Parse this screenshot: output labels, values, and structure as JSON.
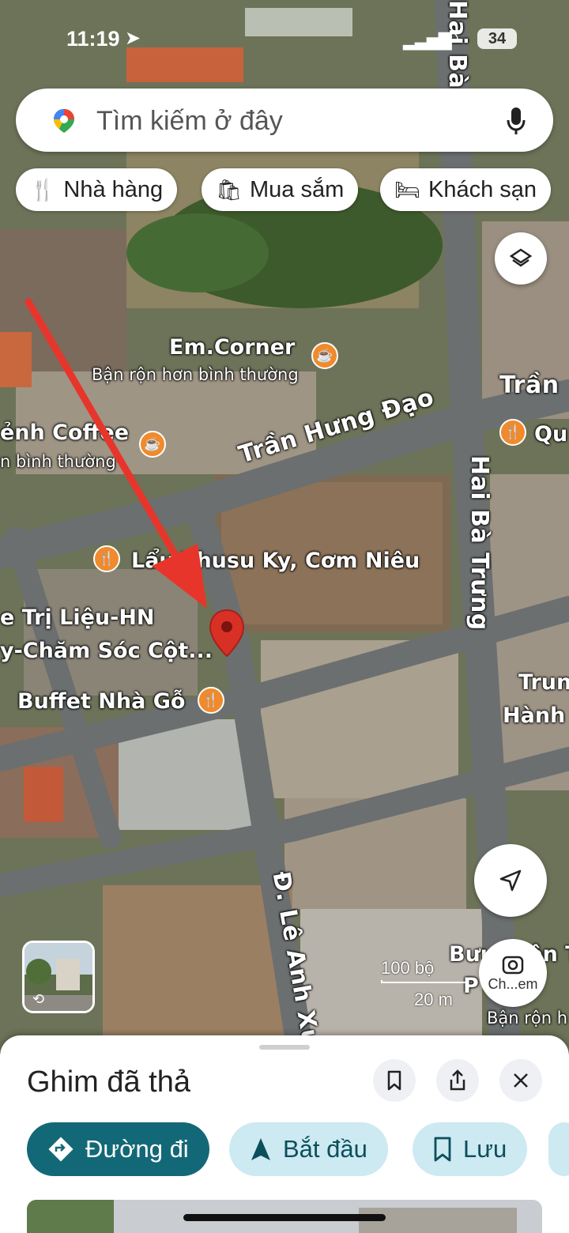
{
  "status_bar": {
    "time": "11:19",
    "battery": "34"
  },
  "search": {
    "placeholder": "Tìm kiếm ở đây"
  },
  "chips": [
    {
      "label": "Nhà hàng",
      "icon": "restaurant-icon"
    },
    {
      "label": "Mua sắm",
      "icon": "shopping-bag-icon"
    },
    {
      "label": "Khách sạn",
      "icon": "hotel-bed-icon"
    }
  ],
  "map": {
    "pois": [
      {
        "name": "Em.Corner",
        "sub": "Bận rộn hơn bình thường"
      },
      {
        "name": "ẻnh Coffee",
        "sub": "n bình thường"
      },
      {
        "name": "Lẩu Thusu Ky, Cơm Niêu"
      },
      {
        "name": "e Trị Liệu-HN",
        "sub": "y-Chăm Sóc Cột..."
      },
      {
        "name": "Buffet Nhà Gỗ"
      },
      {
        "name": "Trun",
        "sub": "Hành"
      },
      {
        "name": "Bưu Điện T",
        "sub": "P",
        "extra": "Bận rộn h"
      },
      {
        "name": "Qu"
      }
    ],
    "streets": {
      "tran_hung_dao": "Trần Hưng Đạo",
      "tran_top_right": "Trần",
      "hai_ba_trung": "Hai Bà Trưng",
      "hai_ba_trung_top": "Hai Bà",
      "le_anh_xuan": "Đ. Lê Anh Xuâ"
    },
    "scale": {
      "feet": "100 bộ",
      "meters": "20 m"
    },
    "lens_label": "Ch...em",
    "annotation_color": "#e8352b",
    "pin_color": "#d93025"
  },
  "sheet": {
    "title": "Ghim đã thả",
    "actions": [
      {
        "label": "Đường đi",
        "icon": "directions-icon"
      },
      {
        "label": "Bắt đầu",
        "icon": "navigation-arrow-icon"
      },
      {
        "label": "Lưu",
        "icon": "bookmark-icon"
      }
    ]
  }
}
